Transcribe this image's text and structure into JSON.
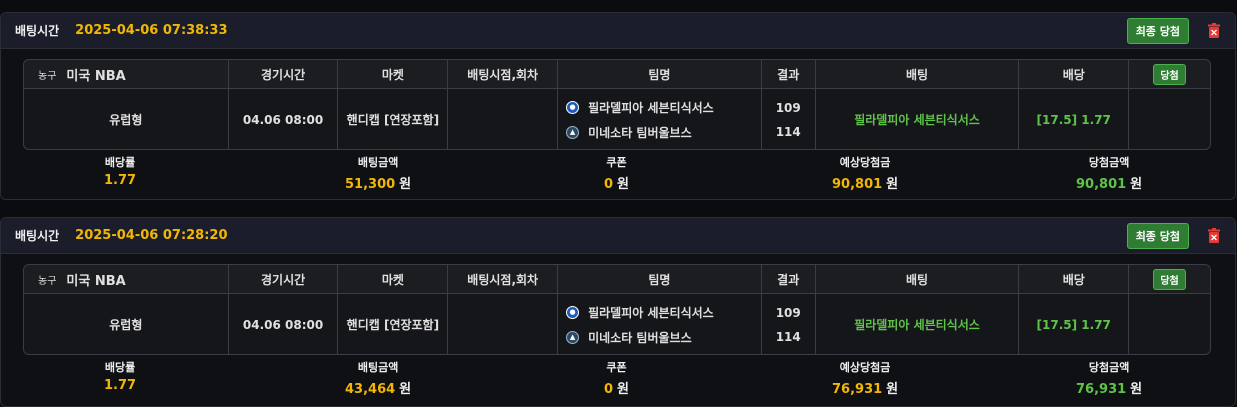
{
  "colors": {
    "accent": "#f2b705",
    "win": "#5fc34a",
    "badge": "#2e7d32",
    "delete": "#e53935"
  },
  "labels": {
    "bet_time": "배팅시간",
    "final_win": "최종 당첨",
    "headers": [
      "경기시간",
      "마켓",
      "배팅시점,회차",
      "팀명",
      "결과",
      "배팅",
      "배당"
    ],
    "win_badge": "당첨",
    "summary": [
      "배당률",
      "배팅금액",
      "쿠폰",
      "예상당첨금",
      "당첨금액"
    ],
    "unit": "원"
  },
  "bets": [
    {
      "time": "2025-04-06 07:38:33",
      "sport": "농구",
      "league": "미국 NBA",
      "type": "유럽형",
      "game_time": "04.06 08:00",
      "market": "핸디캡 [연장포함]",
      "bet_point": "",
      "home": {
        "name": "필라델피아 세븐티식서스",
        "icon": "76ers-logo-icon",
        "score": "109"
      },
      "away": {
        "name": "미네소타 팀버울브스",
        "icon": "timberwolves-logo-icon",
        "score": "114"
      },
      "pick": "필라델피아 세븐티식서스",
      "odds": "[17.5] 1.77",
      "summary": {
        "rate": "1.77",
        "amount": "51,300",
        "coupon": "0",
        "expected": "90,801",
        "won": "90,801"
      }
    },
    {
      "time": "2025-04-06 07:28:20",
      "sport": "농구",
      "league": "미국 NBA",
      "type": "유럽형",
      "game_time": "04.06 08:00",
      "market": "핸디캡 [연장포함]",
      "bet_point": "",
      "home": {
        "name": "필라델피아 세븐티식서스",
        "icon": "76ers-logo-icon",
        "score": "109"
      },
      "away": {
        "name": "미네소타 팀버울브스",
        "icon": "timberwolves-logo-icon",
        "score": "114"
      },
      "pick": "필라델피아 세븐티식서스",
      "odds": "[17.5] 1.77",
      "summary": {
        "rate": "1.77",
        "amount": "43,464",
        "coupon": "0",
        "expected": "76,931",
        "won": "76,931"
      }
    }
  ]
}
